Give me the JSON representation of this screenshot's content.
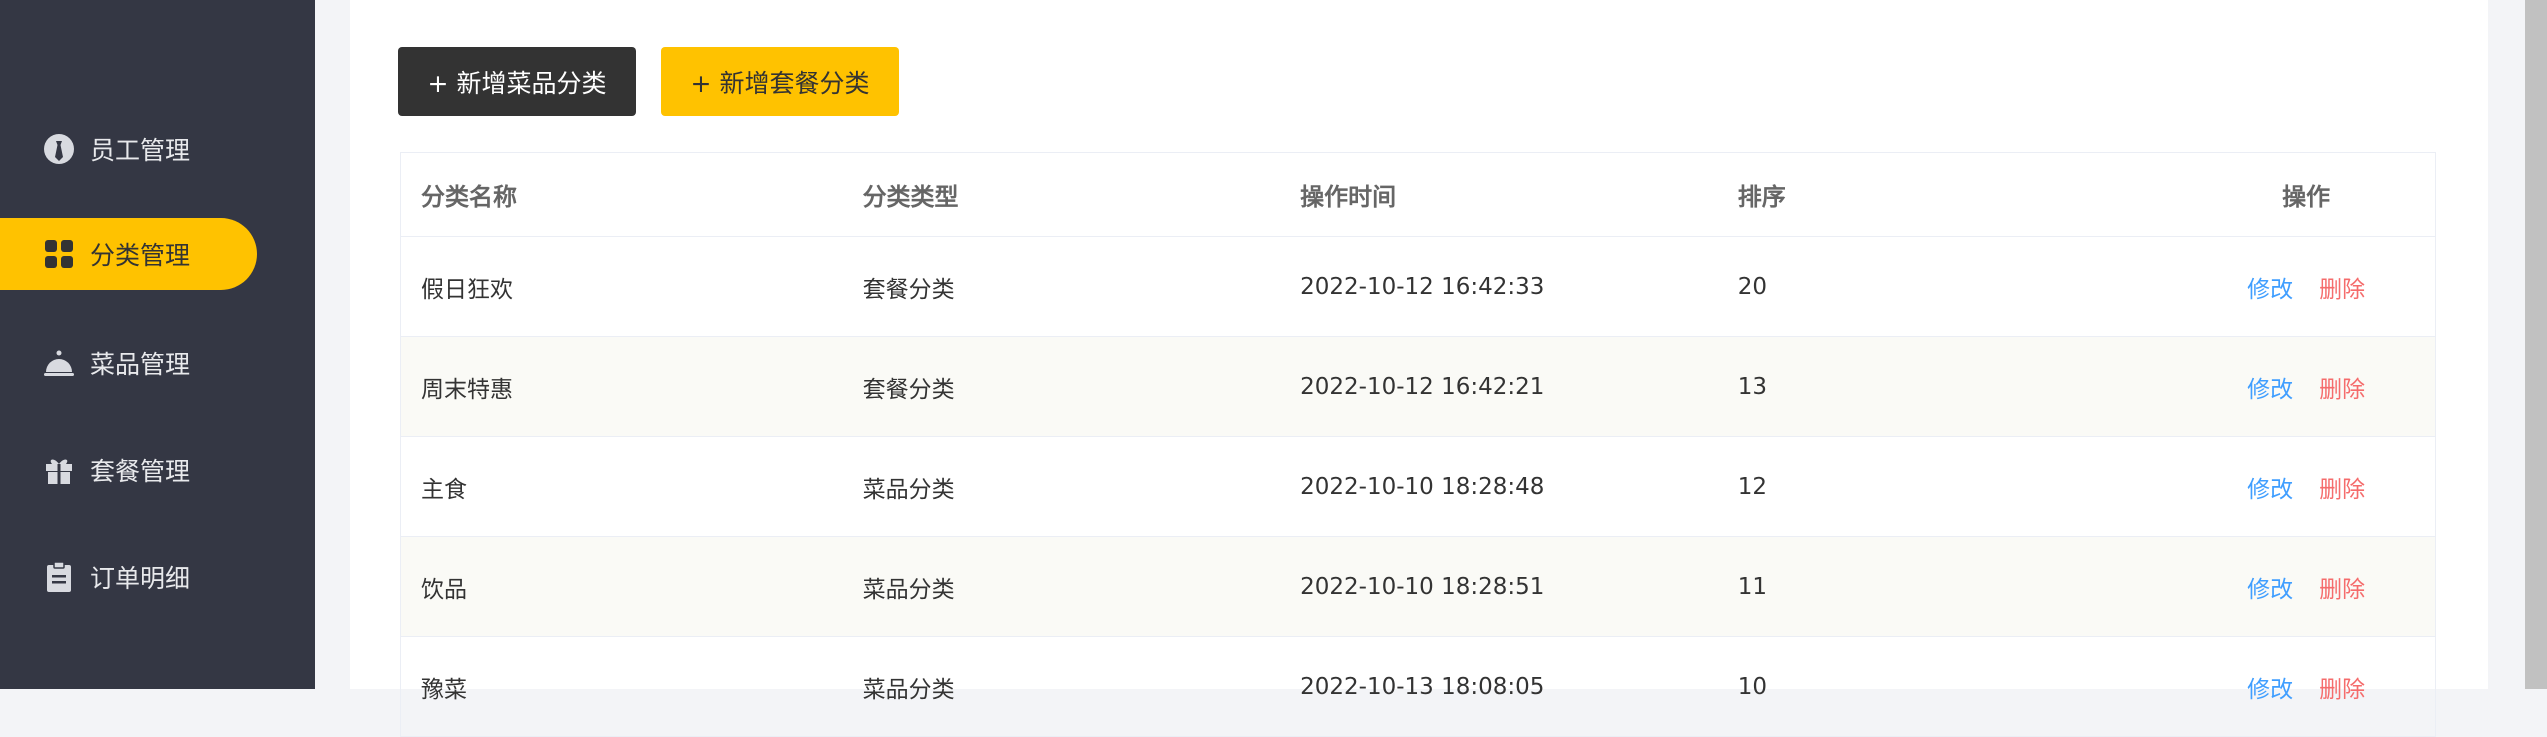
{
  "sidebar": {
    "items": [
      {
        "label": "员工管理",
        "icon": "employee-icon",
        "active": false
      },
      {
        "label": "分类管理",
        "icon": "category-icon",
        "active": true
      },
      {
        "label": "菜品管理",
        "icon": "dish-icon",
        "active": false
      },
      {
        "label": "套餐管理",
        "icon": "gift-icon",
        "active": false
      },
      {
        "label": "订单明细",
        "icon": "clipboard-icon",
        "active": false
      }
    ]
  },
  "toolbar": {
    "add_dish_category_label": "+ 新增菜品分类",
    "add_combo_category_label": "+ 新增套餐分类"
  },
  "table": {
    "headers": {
      "name": "分类名称",
      "type": "分类类型",
      "time": "操作时间",
      "sort": "排序",
      "action": "操作"
    },
    "rows": [
      {
        "name": "假日狂欢",
        "type": "套餐分类",
        "time": "2022-10-12 16:42:33",
        "sort": "20",
        "edit": "修改",
        "delete": "删除"
      },
      {
        "name": "周末特惠",
        "type": "套餐分类",
        "time": "2022-10-12 16:42:21",
        "sort": "13",
        "edit": "修改",
        "delete": "删除"
      },
      {
        "name": "主食",
        "type": "菜品分类",
        "time": "2022-10-10 18:28:48",
        "sort": "12",
        "edit": "修改",
        "delete": "删除"
      },
      {
        "name": "饮品",
        "type": "菜品分类",
        "time": "2022-10-10 18:28:51",
        "sort": "11",
        "edit": "修改",
        "delete": "删除"
      },
      {
        "name": "豫菜",
        "type": "菜品分类",
        "time": "2022-10-13 18:08:05",
        "sort": "10",
        "edit": "修改",
        "delete": "删除"
      }
    ]
  },
  "colors": {
    "sidebar_bg": "#343744",
    "accent": "#ffc200",
    "edit_link": "#409eff",
    "delete_link": "#f56c6c"
  }
}
